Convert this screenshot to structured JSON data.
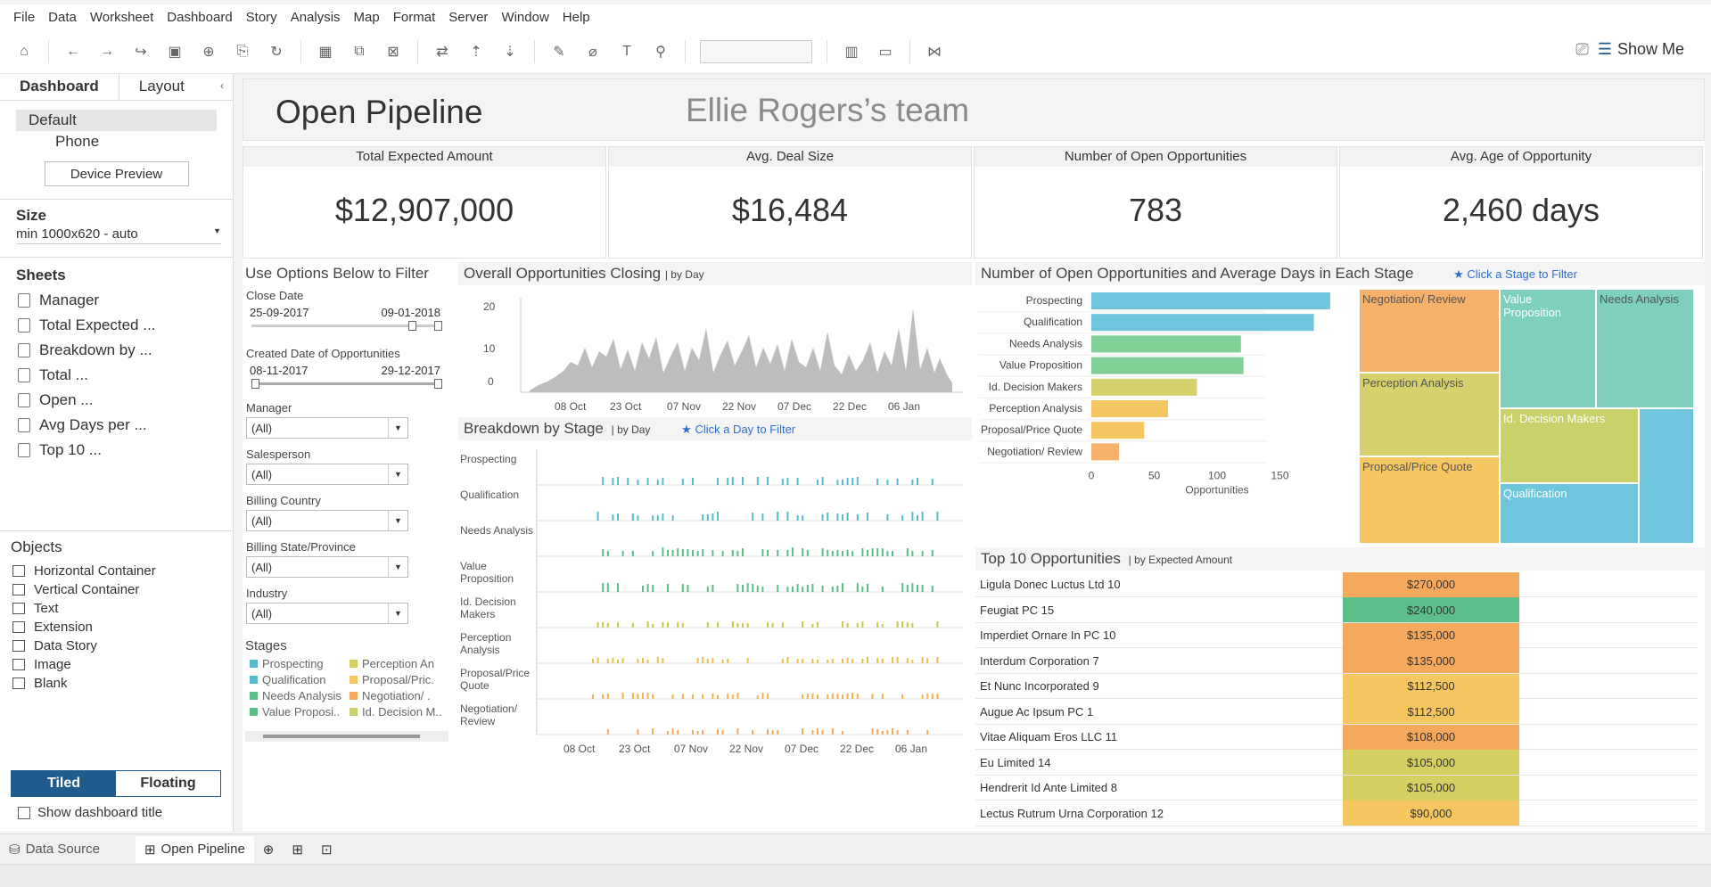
{
  "menu": [
    "File",
    "Data",
    "Worksheet",
    "Dashboard",
    "Story",
    "Analysis",
    "Map",
    "Format",
    "Server",
    "Window",
    "Help"
  ],
  "toolbar": {
    "show_me": "Show Me"
  },
  "left_panel": {
    "tabs": [
      "Dashboard",
      "Layout"
    ],
    "devices": [
      "Default",
      "Phone"
    ],
    "device_preview": "Device Preview",
    "size_label": "Size",
    "size_value": "min 1000x620 - auto",
    "sheets_label": "Sheets",
    "sheets": [
      "Manager",
      "Total Expected ...",
      "Breakdown by ...",
      "Total ...",
      "Open ...",
      "Avg Days per ...",
      "Top 10 ..."
    ],
    "objects_label": "Objects",
    "objects": [
      "Horizontal Container",
      "Vertical Container",
      "Text",
      "Extension",
      "Data Story",
      "Image",
      "Blank"
    ],
    "tiled": "Tiled",
    "floating": "Floating",
    "show_title": "Show dashboard title"
  },
  "dashboard": {
    "title": "Open Pipeline",
    "subtitle": "Ellie Rogers’s team",
    "kpis": [
      {
        "title": "Total Expected Amount",
        "value": "$12,907,000"
      },
      {
        "title": "Avg. Deal Size",
        "value": "$16,484"
      },
      {
        "title": "Number of Open Opportunities",
        "value": "783"
      },
      {
        "title": "Avg. Age of Opportunity",
        "value": "2,460 days"
      }
    ],
    "filters": {
      "header": "Use Options Below to Filter",
      "close_date": {
        "label": "Close Date",
        "from": "25-09-2017",
        "to": "09-01-2018"
      },
      "created_date": {
        "label": "Created Date of Opportunities",
        "from": "08-11-2017",
        "to": "29-12-2017"
      },
      "dropdowns": [
        {
          "label": "Manager",
          "value": "(All)"
        },
        {
          "label": "Salesperson",
          "value": "(All)"
        },
        {
          "label": "Billing Country",
          "value": "(All)"
        },
        {
          "label": "Billing State/Province",
          "value": "(All)"
        },
        {
          "label": "Industry",
          "value": "(All)"
        }
      ],
      "stages_label": "Stages",
      "stages_legend": [
        {
          "name": "Prospecting",
          "color": "#56bccd"
        },
        {
          "name": "Perception An",
          "color": "#d6cf62"
        },
        {
          "name": "Qualification",
          "color": "#56bccd"
        },
        {
          "name": "Proposal/Pric.",
          "color": "#f6c760"
        },
        {
          "name": "Needs Analysis",
          "color": "#5cbf8a"
        },
        {
          "name": "Negotiation/ .",
          "color": "#f5a95d"
        },
        {
          "name": "Value Proposi..",
          "color": "#5cbf8a"
        },
        {
          "name": "Id. Decision M..",
          "color": "#c9d16a"
        }
      ]
    },
    "closing": {
      "title": "Overall Opportunities Closing",
      "suffix": "| by Day",
      "y_ticks": [
        "20",
        "10",
        "0"
      ],
      "x_ticks": [
        "08 Oct",
        "23 Oct",
        "07 Nov",
        "22 Nov",
        "07 Dec",
        "22 Dec",
        "06 Jan"
      ]
    },
    "breakdown": {
      "title": "Breakdown by Stage",
      "suffix": "| by Day",
      "hint": "★ Click a Day to Filter",
      "rows": [
        "Prospecting",
        "Qualification",
        "Needs Analysis",
        "Value Proposition",
        "Id. Decision Makers",
        "Perception Analysis",
        "Proposal/Price Quote",
        "Negotiation/ Review"
      ],
      "x_ticks": [
        "08 Oct",
        "23 Oct",
        "07 Nov",
        "22 Nov",
        "07 Dec",
        "22 Dec",
        "06 Jan"
      ]
    },
    "stage_bars": {
      "title": "Number of Open Opportunities and Average Days in Each Stage",
      "hint": "★ Click a Stage to Filter",
      "xlabel": "Opportunities",
      "x_ticks": [
        "0",
        "50",
        "100",
        "150"
      ]
    },
    "treemap": [
      "Negotiation/ Review",
      "Value Proposition",
      "Needs Analysis",
      "Perception Analysis",
      "Id. Decision Makers",
      "Proposal/Price Quote",
      "Qualification"
    ],
    "top10": {
      "title": "Top 10 Opportunities",
      "suffix": "| by Expected Amount",
      "rows": [
        {
          "name": "Ligula Donec Luctus Ltd 10",
          "value": "$270,000",
          "color": "#f5a95d"
        },
        {
          "name": "Feugiat PC 15",
          "value": "$240,000",
          "color": "#5cbf8a"
        },
        {
          "name": "Imperdiet Ornare In PC 10",
          "value": "$135,000",
          "color": "#f5a95d"
        },
        {
          "name": "Interdum Corporation 7",
          "value": "$135,000",
          "color": "#f5a95d"
        },
        {
          "name": "Et Nunc Incorporated 9",
          "value": "$112,500",
          "color": "#f6c760"
        },
        {
          "name": "Augue Ac Ipsum PC 1",
          "value": "$112,500",
          "color": "#f6c760"
        },
        {
          "name": "Vitae Aliquam Eros LLC 11",
          "value": "$108,000",
          "color": "#f5a95d"
        },
        {
          "name": "Eu Limited 14",
          "value": "$105,000",
          "color": "#d6cf62"
        },
        {
          "name": "Hendrerit Id Ante Limited 8",
          "value": "$105,000",
          "color": "#d6cf62"
        },
        {
          "name": "Lectus Rutrum Urna Corporation 12",
          "value": "$90,000",
          "color": "#f6c760"
        }
      ]
    }
  },
  "bottom_tabs": [
    "Data Source",
    "Open Pipeline"
  ],
  "chart_data": [
    {
      "type": "bar",
      "categories": [
        "Prospecting",
        "Qualification",
        "Needs Analysis",
        "Value Proposition",
        "Id. Decision Makers",
        "Perception Analysis",
        "Proposal/Price Quote",
        "Negotiation/ Review"
      ],
      "values": [
        190,
        177,
        119,
        121,
        84,
        61,
        42,
        22
      ],
      "colors": [
        "#6dc6dc",
        "#6dc6dc",
        "#7fcf97",
        "#7fcf97",
        "#d6d06d",
        "#f6c760",
        "#f6c760",
        "#f6b16a"
      ],
      "xlabel": "Opportunities",
      "xlim": [
        0,
        200
      ]
    }
  ]
}
